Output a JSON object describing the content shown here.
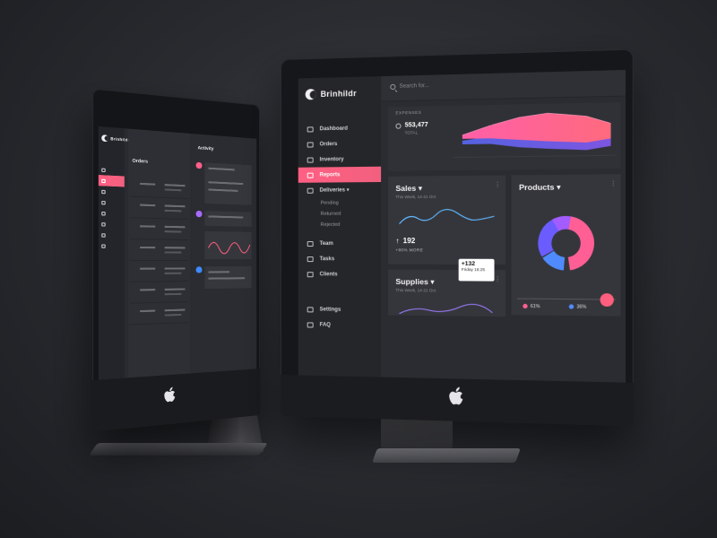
{
  "right_app": {
    "brand": "Brinhildr",
    "search_placeholder": "Search for...",
    "nav": [
      {
        "label": "Dashboard",
        "icon": "dashboard-icon"
      },
      {
        "label": "Orders",
        "icon": "orders-icon"
      },
      {
        "label": "Inventory",
        "icon": "inventory-icon"
      },
      {
        "label": "Reports",
        "icon": "reports-icon",
        "active": true
      },
      {
        "label": "Deliveries ▾",
        "icon": "deliveries-icon"
      }
    ],
    "deliveries_sub": [
      "Pending",
      "Returned",
      "Rejected"
    ],
    "nav2": [
      {
        "label": "Team",
        "icon": "team-icon"
      },
      {
        "label": "Tasks",
        "icon": "tasks-icon"
      },
      {
        "label": "Clients",
        "icon": "clients-icon"
      }
    ],
    "nav3": [
      {
        "label": "Settings",
        "icon": "settings-icon"
      },
      {
        "label": "FAQ",
        "icon": "faq-icon"
      }
    ],
    "expenses": {
      "label": "EXPENSES",
      "value": "553,477",
      "sub": "TOTAL"
    },
    "sales": {
      "title": "Sales ▾",
      "sub": "This Week, 14-21 Oct",
      "value": "192",
      "more": "+80% MORE"
    },
    "products": {
      "title": "Products ▾",
      "legend": [
        "61%",
        "36%"
      ]
    },
    "supplies": {
      "title": "Supplies ▾",
      "sub": "This Week, 14-21 Oct"
    },
    "tooltip": {
      "value": "+132",
      "sub": "Friday 16:25"
    },
    "accent": "#ff5f82"
  },
  "left_app": {
    "brand": "Brinhildr",
    "orders_title": "Orders",
    "activity_title": "Activity"
  }
}
